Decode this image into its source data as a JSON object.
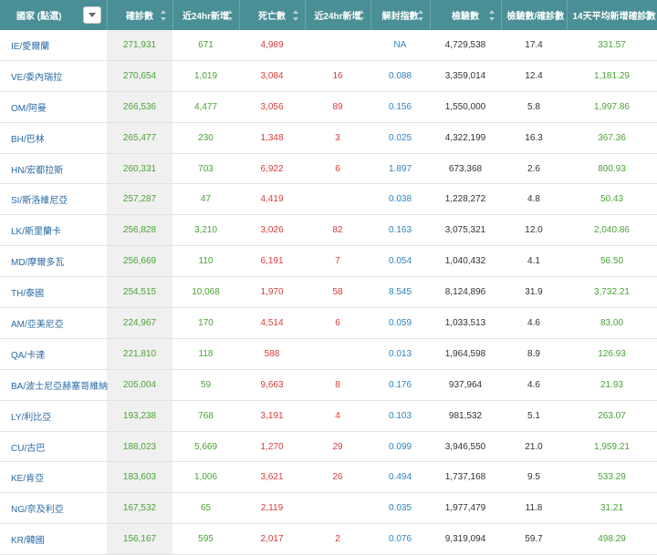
{
  "columns": [
    "國家 (點選)",
    "確診數",
    "近24hr新增",
    "死亡數",
    "近24hr新增",
    "解封指數",
    "檢驗數",
    "檢驗數/確診數",
    "14天平均新增確診數"
  ],
  "rows": [
    {
      "country": "IE/愛爾蘭",
      "confirmed": "271,931",
      "new_24h": "671",
      "deaths": "4,989",
      "deaths_24h": "",
      "unlock_index": "NA",
      "tests": "4,729,538",
      "tests_per_case": "17.4",
      "avg14": "331.57"
    },
    {
      "country": "VE/委內瑞拉",
      "confirmed": "270,654",
      "new_24h": "1,019",
      "deaths": "3,084",
      "deaths_24h": "16",
      "unlock_index": "0.088",
      "tests": "3,359,014",
      "tests_per_case": "12.4",
      "avg14": "1,181.29"
    },
    {
      "country": "OM/阿曼",
      "confirmed": "266,536",
      "new_24h": "4,477",
      "deaths": "3,056",
      "deaths_24h": "89",
      "unlock_index": "0.156",
      "tests": "1,550,000",
      "tests_per_case": "5.8",
      "avg14": "1,997.86"
    },
    {
      "country": "BH/巴林",
      "confirmed": "265,477",
      "new_24h": "230",
      "deaths": "1,348",
      "deaths_24h": "3",
      "unlock_index": "0.025",
      "tests": "4,322,199",
      "tests_per_case": "16.3",
      "avg14": "367.36"
    },
    {
      "country": "HN/宏都拉斯",
      "confirmed": "260,331",
      "new_24h": "703",
      "deaths": "6,922",
      "deaths_24h": "6",
      "unlock_index": "1.897",
      "tests": "673,368",
      "tests_per_case": "2.6",
      "avg14": "800.93"
    },
    {
      "country": "SI/斯洛維尼亞",
      "confirmed": "257,287",
      "new_24h": "47",
      "deaths": "4,419",
      "deaths_24h": "",
      "unlock_index": "0.038",
      "tests": "1,228,272",
      "tests_per_case": "4.8",
      "avg14": "50.43"
    },
    {
      "country": "LK/斯里蘭卡",
      "confirmed": "256,828",
      "new_24h": "3,210",
      "deaths": "3,026",
      "deaths_24h": "82",
      "unlock_index": "0.163",
      "tests": "3,075,321",
      "tests_per_case": "12.0",
      "avg14": "2,040.86"
    },
    {
      "country": "MD/摩爾多瓦",
      "confirmed": "256,669",
      "new_24h": "110",
      "deaths": "6,191",
      "deaths_24h": "7",
      "unlock_index": "0.054",
      "tests": "1,040,432",
      "tests_per_case": "4.1",
      "avg14": "56.50"
    },
    {
      "country": "TH/泰國",
      "confirmed": "254,515",
      "new_24h": "10,068",
      "deaths": "1,970",
      "deaths_24h": "58",
      "unlock_index": "8.545",
      "tests": "8,124,896",
      "tests_per_case": "31.9",
      "avg14": "3,732.21"
    },
    {
      "country": "AM/亞美尼亞",
      "confirmed": "224,967",
      "new_24h": "170",
      "deaths": "4,514",
      "deaths_24h": "6",
      "unlock_index": "0.059",
      "tests": "1,033,513",
      "tests_per_case": "4.6",
      "avg14": "83.00"
    },
    {
      "country": "QA/卡達",
      "confirmed": "221,810",
      "new_24h": "118",
      "deaths": "588",
      "deaths_24h": "",
      "unlock_index": "0.013",
      "tests": "1,964,598",
      "tests_per_case": "8.9",
      "avg14": "126.93"
    },
    {
      "country": "BA/波士尼亞赫塞哥維納",
      "confirmed": "205,004",
      "new_24h": "59",
      "deaths": "9,663",
      "deaths_24h": "8",
      "unlock_index": "0.176",
      "tests": "937,964",
      "tests_per_case": "4.6",
      "avg14": "21.93"
    },
    {
      "country": "LY/利比亞",
      "confirmed": "193,238",
      "new_24h": "768",
      "deaths": "3,191",
      "deaths_24h": "4",
      "unlock_index": "0.103",
      "tests": "981,532",
      "tests_per_case": "5.1",
      "avg14": "263.07"
    },
    {
      "country": "CU/古巴",
      "confirmed": "188,023",
      "new_24h": "5,669",
      "deaths": "1,270",
      "deaths_24h": "29",
      "unlock_index": "0.099",
      "tests": "3,946,550",
      "tests_per_case": "21.0",
      "avg14": "1,959.21"
    },
    {
      "country": "KE/肯亞",
      "confirmed": "183,603",
      "new_24h": "1,006",
      "deaths": "3,621",
      "deaths_24h": "26",
      "unlock_index": "0.494",
      "tests": "1,737,168",
      "tests_per_case": "9.5",
      "avg14": "533.29"
    },
    {
      "country": "NG/奈及利亞",
      "confirmed": "167,532",
      "new_24h": "65",
      "deaths": "2,119",
      "deaths_24h": "",
      "unlock_index": "0.035",
      "tests": "1,977,479",
      "tests_per_case": "11.8",
      "avg14": "31.21"
    },
    {
      "country": "KR/韓國",
      "confirmed": "156,167",
      "new_24h": "595",
      "deaths": "2,017",
      "deaths_24h": "2",
      "unlock_index": "0.076",
      "tests": "9,319,094",
      "tests_per_case": "59.7",
      "avg14": "498.29"
    }
  ],
  "colors": {
    "header_bg": "#4a8f96",
    "positive_green": "#4aa334",
    "death_red": "#d83a3a",
    "link_blue": "#2a6aa3",
    "index_blue": "#2a86c2"
  },
  "icons": {
    "filter": "chevron-down-icon",
    "sort": "sort-icon"
  }
}
